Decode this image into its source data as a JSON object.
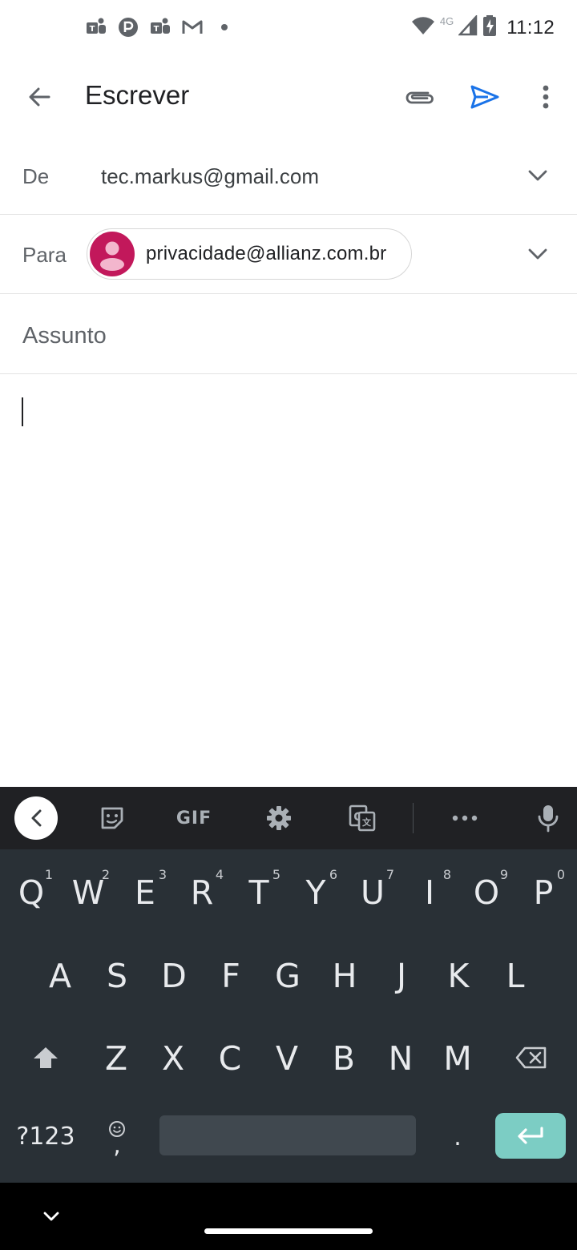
{
  "status_bar": {
    "time": "11:12",
    "network_label": "4G",
    "notification_icons": [
      "teams-icon",
      "p-app-icon",
      "teams-icon",
      "gmail-icon",
      "dot-icon"
    ],
    "system_icons": [
      "wifi-icon",
      "cell-signal-icon",
      "battery-charging-icon"
    ]
  },
  "app_bar": {
    "title": "Escrever",
    "actions": [
      "attach-icon",
      "send-icon",
      "more-vert-icon"
    ],
    "send_color": "#1a73e8"
  },
  "compose": {
    "from_label": "De",
    "from_value": "tec.markus@gmail.com",
    "to_label": "Para",
    "to_chip": "privacidade@allianz.com.br",
    "avatar_color": "#c2185b",
    "subject_placeholder": "Assunto",
    "subject_value": "",
    "body_value": ""
  },
  "keyboard": {
    "toolbar": {
      "gif_label": "GIF",
      "items": [
        "back-chevron-icon",
        "sticker-icon",
        "gif-button",
        "settings-icon",
        "translate-icon",
        "more-horiz-icon",
        "mic-icon"
      ]
    },
    "rows": [
      [
        {
          "key": "Q",
          "hint": "1"
        },
        {
          "key": "W",
          "hint": "2"
        },
        {
          "key": "E",
          "hint": "3"
        },
        {
          "key": "R",
          "hint": "4"
        },
        {
          "key": "T",
          "hint": "5"
        },
        {
          "key": "Y",
          "hint": "6"
        },
        {
          "key": "U",
          "hint": "7"
        },
        {
          "key": "I",
          "hint": "8"
        },
        {
          "key": "O",
          "hint": "9"
        },
        {
          "key": "P",
          "hint": "0"
        }
      ],
      [
        {
          "key": "A"
        },
        {
          "key": "S"
        },
        {
          "key": "D"
        },
        {
          "key": "F"
        },
        {
          "key": "G"
        },
        {
          "key": "H"
        },
        {
          "key": "J"
        },
        {
          "key": "K"
        },
        {
          "key": "L"
        }
      ],
      [
        {
          "key": "Z"
        },
        {
          "key": "X"
        },
        {
          "key": "C"
        },
        {
          "key": "V"
        },
        {
          "key": "B"
        },
        {
          "key": "N"
        },
        {
          "key": "M"
        }
      ]
    ],
    "symbols_label": "?123",
    "comma_label": ",",
    "period_label": ".",
    "enter_color": "#7ccdc4"
  },
  "nav_bar": {
    "items": [
      "nav-collapse-chevron-icon",
      "home-pill"
    ]
  }
}
